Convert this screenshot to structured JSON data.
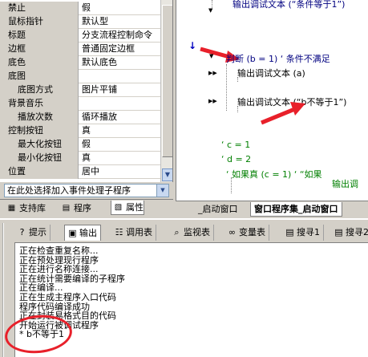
{
  "properties": [
    {
      "name": "禁止",
      "value": "假",
      "indent": false
    },
    {
      "name": "鼠标指针",
      "value": "默认型",
      "indent": false
    },
    {
      "name": "标题",
      "value": "分支流程控制命令",
      "indent": false
    },
    {
      "name": "边框",
      "value": "普通固定边框",
      "indent": false
    },
    {
      "name": "底色",
      "value": "默认底色",
      "indent": false
    },
    {
      "name": "底图",
      "value": "",
      "indent": false
    },
    {
      "name": "底图方式",
      "value": "图片平铺",
      "indent": true
    },
    {
      "name": "背景音乐",
      "value": "",
      "indent": false
    },
    {
      "name": "播放次数",
      "value": "循环播放",
      "indent": true
    },
    {
      "name": "控制按钮",
      "value": "真",
      "indent": false
    },
    {
      "name": "最大化按钮",
      "value": "假",
      "indent": true
    },
    {
      "name": "最小化按钮",
      "value": "真",
      "indent": true
    },
    {
      "name": "位置",
      "value": "居中",
      "indent": false
    }
  ],
  "event_combo": {
    "text": "在此处选择加入事件处理子程序"
  },
  "left_tabs": [
    {
      "label": "支持库",
      "icon": "library-icon"
    },
    {
      "label": "程序",
      "icon": "program-icon"
    },
    {
      "label": "属性",
      "icon": "property-icon",
      "active": true
    }
  ],
  "code": {
    "top_line": "输出调试文本 (“条件等于1”)",
    "judge_line": "判断 (b = 1)  ‘ 条件不满足",
    "debug_a": "输出调试文本 (a)",
    "debug_neq": "输出调试文本 (“b不等于1”)",
    "c_line": "‘ c = 1",
    "d_line": "‘ d = 2",
    "if_line": "‘ 如果真 (c = 1)  ‘ “如果",
    "if_body": "输出调"
  },
  "right_tabs": [
    {
      "label": "_启动窗口",
      "active": false
    },
    {
      "label": "窗口程序集_启动窗口",
      "active": true
    }
  ],
  "bottom_tabs": [
    {
      "label": "提示",
      "icon": "hint-icon"
    },
    {
      "label": "输出",
      "icon": "output-icon",
      "active": true
    },
    {
      "label": "调用表",
      "icon": "call-table-icon"
    },
    {
      "label": "监视表",
      "icon": "watch-table-icon"
    },
    {
      "label": "变量表",
      "icon": "variable-table-icon"
    },
    {
      "label": "搜寻1",
      "icon": "search1-icon"
    },
    {
      "label": "搜寻2",
      "icon": "search2-icon"
    }
  ],
  "output_lines": [
    "正在检查重复名称...",
    "正在预处理现行程序",
    "正在进行名称连接...",
    "正在统计需要编译的子程序",
    "正在编译...",
    "正在生成主程序入口代码",
    "程序代码编译成功",
    "正在封装易格式目的代码",
    "开始运行被调试程序",
    "* b不等于1"
  ],
  "colors": {
    "annotation_red": "#e8202a",
    "comment_green": "#007f00"
  }
}
